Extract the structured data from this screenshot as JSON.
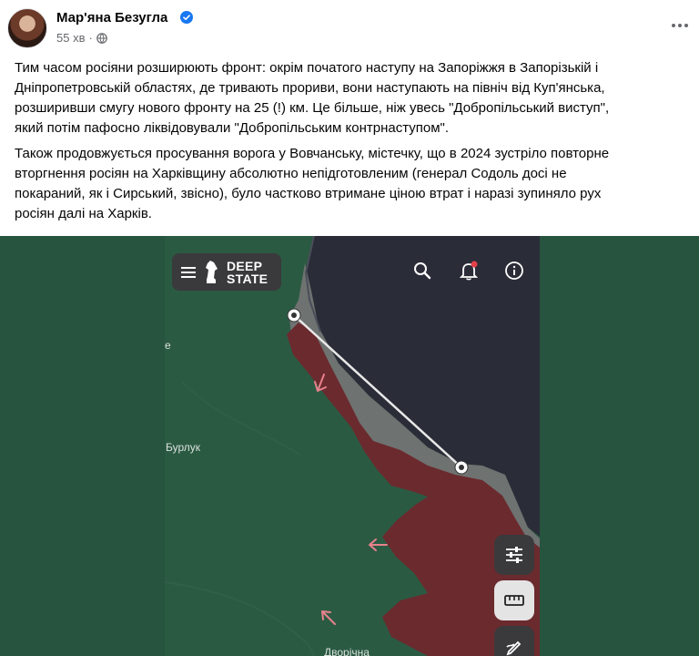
{
  "post": {
    "author": "Мар'яна Безугла",
    "time": "55 хв",
    "separator": "·",
    "paragraphs": [
      "Тим часом росіяни розширюють фронт: окрім початого наступу на Запоріжжя в Запорізькій і\nДніпропетровській областях, де тривають прориви, вони наступають на північ від Куп'янська,\nрозширивши смугу нового фронту на 25 (!) км. Це більше, ніж увесь \"Добропільський виступ\",\nякий потім пафосно ліквідовували \"Добропільським контрнаступом\".",
      "Також продовжується просування ворога у Вовчанську, містечку, що в 2024 зустріло повторне\nвторгнення росіян на Харківщину абсолютно непідготовленим (генерал Содоль досі не\nпокараний, як і Сирський, звісно), було частково втримане ціною втрат і наразі зупиняло рух\nросіян далі на Харків."
    ]
  },
  "map_app": {
    "logo_line1": "DEEP",
    "logo_line2": "STATE",
    "labels": {
      "burluk": "Бурлук",
      "dvorichna": "Дворічна",
      "edge": "е"
    },
    "icons": [
      "menu-icon",
      "search-icon",
      "notifications-icon",
      "info-icon",
      "filters-icon",
      "ruler-icon",
      "draw-icon"
    ]
  },
  "colors": {
    "occupied": "#6b2a2e",
    "gray_zone": "#6e7270",
    "russia": "#2a2d38",
    "ukraine": "#27543f",
    "verified_blue": "#1877f2",
    "notification_dot": "#e4404a"
  }
}
